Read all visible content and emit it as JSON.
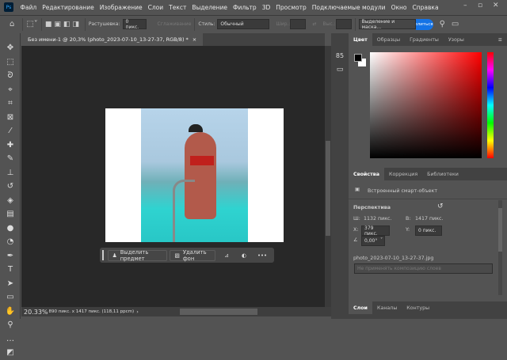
{
  "menubar": {
    "items": [
      "Файл",
      "Редактирование",
      "Изображение",
      "Слои",
      "Текст",
      "Выделение",
      "Фильтр",
      "3D",
      "Просмотр",
      "Подключаемые модули",
      "Окно",
      "Справка"
    ],
    "logo": "Ps"
  },
  "options": {
    "feather_label": "Растушевка:",
    "feather_value": "0 пикс.",
    "antialias": "Сглаживание",
    "style_label": "Стиль:",
    "style_value": "Обычный",
    "width_label": "Шир.:",
    "height_label": "Выс.:",
    "select_mask": "Выделение и маска...",
    "share": "Поделиться"
  },
  "document": {
    "tab_title": "Без имени-1 @ 20,3% (photo_2023-07-10_13-27-37, RGB/8) *"
  },
  "context_bar": {
    "select_subject": "Выделить предмет",
    "remove_bg": "Удалить фон"
  },
  "status": {
    "zoom": "20.33%",
    "info": "890 пикс. x 1417 пикс. (118,11 ppcm)"
  },
  "color_panel": {
    "tabs": [
      "Цвет",
      "Образцы",
      "Градиенты",
      "Узоры"
    ],
    "foreground": "#000000",
    "background": "#ffffff"
  },
  "properties": {
    "tabs": [
      "Свойства",
      "Коррекция",
      "Библиотеки"
    ],
    "type": "Встроенный смарт-объект",
    "section": "Перспектива",
    "w_label": "Ш:",
    "w_value": "1132 пикс.",
    "h_label": "В:",
    "h_value": "1417 пикс.",
    "x_label": "X:",
    "x_value": "379 пикс.",
    "y_label": "Y:",
    "y_value": "0 пикс.",
    "angle": "0,00°",
    "filename": "photo_2023-07-10_13-27-37.jpg",
    "comp_placeholder": "Не применять композицию слоев"
  },
  "layers_panel": {
    "tabs": [
      "Слои",
      "Каналы",
      "Контуры"
    ]
  }
}
